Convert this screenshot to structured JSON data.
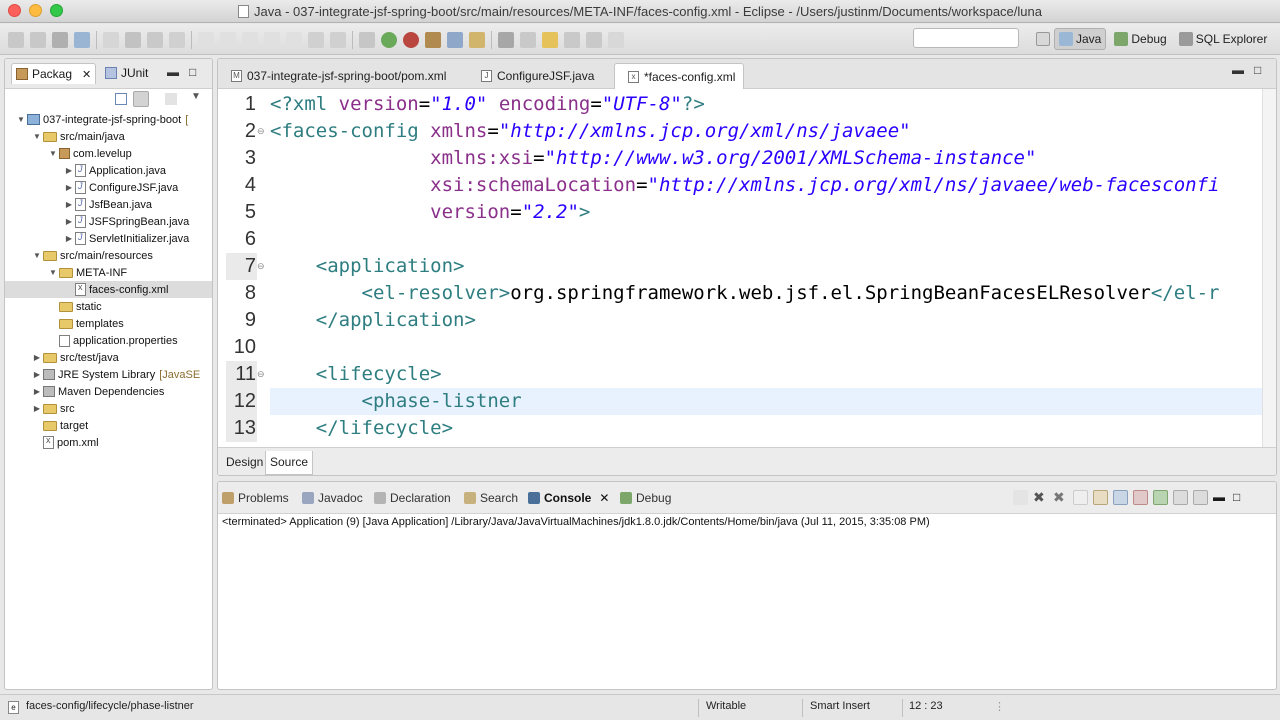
{
  "window": {
    "title": "Java - 037-integrate-jsf-spring-boot/src/main/resources/META-INF/faces-config.xml - Eclipse - /Users/justinm/Documents/workspace/luna"
  },
  "perspectives": [
    {
      "label": "Java",
      "active": true
    },
    {
      "label": "Debug",
      "active": false
    },
    {
      "label": "SQL Explorer",
      "active": false
    }
  ],
  "left_tabs": {
    "package": "Packag",
    "junit": "JUnit"
  },
  "tree": [
    {
      "label": "037-integrate-jsf-spring-boot",
      "suffix": "[",
      "indent": 0,
      "arrow": "▼",
      "icon": "project"
    },
    {
      "label": "src/main/java",
      "indent": 1,
      "arrow": "▼",
      "icon": "package-folder"
    },
    {
      "label": "com.levelup",
      "indent": 2,
      "arrow": "▼",
      "icon": "package"
    },
    {
      "label": "Application.java",
      "indent": 3,
      "arrow": "▶",
      "icon": "java-file"
    },
    {
      "label": "ConfigureJSF.java",
      "indent": 3,
      "arrow": "▶",
      "icon": "java-file"
    },
    {
      "label": "JsfBean.java",
      "indent": 3,
      "arrow": "▶",
      "icon": "java-file"
    },
    {
      "label": "JSFSpringBean.java",
      "indent": 3,
      "arrow": "▶",
      "icon": "java-file"
    },
    {
      "label": "ServletInitializer.java",
      "indent": 3,
      "arrow": "▶",
      "icon": "java-file"
    },
    {
      "label": "src/main/resources",
      "indent": 1,
      "arrow": "▼",
      "icon": "package-folder"
    },
    {
      "label": "META-INF",
      "indent": 2,
      "arrow": "▼",
      "icon": "folder"
    },
    {
      "label": "faces-config.xml",
      "indent": 3,
      "arrow": "",
      "icon": "xml-file",
      "selected": true
    },
    {
      "label": "static",
      "indent": 2,
      "arrow": "",
      "icon": "folder"
    },
    {
      "label": "templates",
      "indent": 2,
      "arrow": "",
      "icon": "folder"
    },
    {
      "label": "application.properties",
      "indent": 2,
      "arrow": "",
      "icon": "properties-file"
    },
    {
      "label": "src/test/java",
      "indent": 1,
      "arrow": "▶",
      "icon": "package-folder"
    },
    {
      "label": "JRE System Library",
      "suffix": "[JavaSE",
      "indent": 1,
      "arrow": "▶",
      "icon": "library"
    },
    {
      "label": "Maven Dependencies",
      "indent": 1,
      "arrow": "▶",
      "icon": "library"
    },
    {
      "label": "src",
      "indent": 1,
      "arrow": "▶",
      "icon": "folder"
    },
    {
      "label": "target",
      "indent": 1,
      "arrow": "",
      "icon": "folder"
    },
    {
      "label": "pom.xml",
      "indent": 1,
      "arrow": "",
      "icon": "xml-file"
    }
  ],
  "editor_tabs": [
    {
      "label": "037-integrate-jsf-spring-boot/pom.xml",
      "icon": "M",
      "active": false
    },
    {
      "label": "ConfigureJSF.java",
      "icon": "J",
      "active": false
    },
    {
      "label": "*faces-config.xml",
      "icon": "x",
      "active": true
    }
  ],
  "code": [
    {
      "n": "1",
      "parts": [
        [
          "tg",
          "<?xml "
        ],
        [
          "at",
          "version"
        ],
        [
          "plain",
          "="
        ],
        [
          "av",
          "\"1.0\""
        ],
        [
          "plain",
          " "
        ],
        [
          "at",
          "encoding"
        ],
        [
          "plain",
          "="
        ],
        [
          "av",
          "\"UTF-8\""
        ],
        [
          "tg",
          "?>"
        ]
      ]
    },
    {
      "n": "2",
      "fold": true,
      "parts": [
        [
          "tg",
          "<faces-config "
        ],
        [
          "at",
          "xmlns"
        ],
        [
          "plain",
          "="
        ],
        [
          "av",
          "\"http://xmlns.jcp.org/xml/ns/javaee\""
        ]
      ]
    },
    {
      "n": "3",
      "parts": [
        [
          "plain",
          "              "
        ],
        [
          "at",
          "xmlns:xsi"
        ],
        [
          "plain",
          "="
        ],
        [
          "av",
          "\"http://www.w3.org/2001/XMLSchema-instance\""
        ]
      ]
    },
    {
      "n": "4",
      "parts": [
        [
          "plain",
          "              "
        ],
        [
          "at",
          "xsi:schemaLocation"
        ],
        [
          "plain",
          "="
        ],
        [
          "av",
          "\"http://xmlns.jcp.org/xml/ns/javaee/web-facesconfi"
        ]
      ]
    },
    {
      "n": "5",
      "parts": [
        [
          "plain",
          "              "
        ],
        [
          "at",
          "version"
        ],
        [
          "plain",
          "="
        ],
        [
          "av",
          "\"2.2\""
        ],
        [
          "tg",
          ">"
        ]
      ]
    },
    {
      "n": "6",
      "parts": []
    },
    {
      "n": "7",
      "fold": true,
      "gutter_hl": true,
      "parts": [
        [
          "plain",
          "    "
        ],
        [
          "tg",
          "<application>"
        ]
      ]
    },
    {
      "n": "8",
      "parts": [
        [
          "plain",
          "        "
        ],
        [
          "tg",
          "<el-resolver>"
        ],
        [
          "plain",
          "org.springframework.web.jsf.el.SpringBeanFacesELResolver"
        ],
        [
          "tg",
          "</el-r"
        ]
      ]
    },
    {
      "n": "9",
      "parts": [
        [
          "plain",
          "    "
        ],
        [
          "tg",
          "</application>"
        ]
      ]
    },
    {
      "n": "10",
      "parts": []
    },
    {
      "n": "11",
      "fold": true,
      "gutter_hl": true,
      "parts": [
        [
          "plain",
          "    "
        ],
        [
          "tg",
          "<lifecycle>"
        ]
      ]
    },
    {
      "n": "12",
      "current": true,
      "gutter_hl": true,
      "parts": [
        [
          "plain",
          "        "
        ],
        [
          "tg",
          "<phase-listner"
        ]
      ]
    },
    {
      "n": "13",
      "gutter_hl": true,
      "parts": [
        [
          "plain",
          "    "
        ],
        [
          "tg",
          "</lifecycle>"
        ]
      ]
    }
  ],
  "editor_footer": {
    "design": "Design",
    "source": "Source"
  },
  "bottom_tabs": [
    {
      "label": "Problems",
      "active": false
    },
    {
      "label": "Javadoc",
      "active": false
    },
    {
      "label": "Declaration",
      "active": false
    },
    {
      "label": "Search",
      "active": false
    },
    {
      "label": "Console",
      "active": true
    },
    {
      "label": "Debug",
      "active": false
    }
  ],
  "console": {
    "status_line": "<terminated> Application (9) [Java Application] /Library/Java/JavaVirtualMachines/jdk1.8.0.jdk/Contents/Home/bin/java (Jul 11, 2015, 3:35:08 PM)"
  },
  "statusbar": {
    "path": "faces-config/lifecycle/phase-listner",
    "writable": "Writable",
    "insert_mode": "Smart Insert",
    "position": "12 : 23"
  },
  "colors": {
    "tag": "#2e7d80",
    "attribute": "#8a2f8a",
    "attribute_value": "#2a00ff",
    "current_line": "#e8f2fe"
  }
}
